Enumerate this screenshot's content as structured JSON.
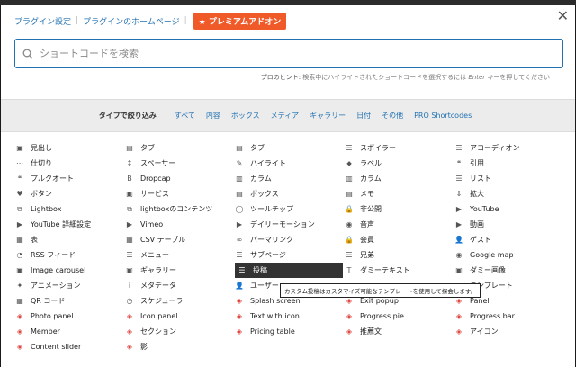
{
  "topbar": {
    "plugin_settings": "プラグイン設定",
    "plugin_home": "プラグインのホームページ",
    "separator": "|",
    "premium_label": "★ プレミアムアドオン",
    "close": "✕"
  },
  "search": {
    "placeholder": "ショートコードを検索"
  },
  "hint": {
    "prefix": "プロのヒント:",
    "text1": " 検索中にハイライトされたショートコードを選択するには ",
    "key": "Enter",
    "text2": " キーを押してください"
  },
  "filters": {
    "label": "タイプで絞り込み",
    "tabs": [
      "すべて",
      "内容",
      "ボックス",
      "メディア",
      "ギャラリー",
      "日付",
      "その他",
      "PRO Shortcodes"
    ]
  },
  "tooltip": "カスタム投稿はカスタマイズ可能なテンプレートを使用して探会します。",
  "rows": [
    [
      [
        "見出し",
        "▣",
        ""
      ],
      [
        "タブ",
        "▤",
        ""
      ],
      [
        "タブ",
        "▤",
        ""
      ],
      [
        "スポイラー",
        "☰",
        ""
      ],
      [
        "アコーディオン",
        "☰",
        ""
      ]
    ],
    [
      [
        "仕切り",
        "⋯",
        ""
      ],
      [
        "スペーサー",
        "↕",
        ""
      ],
      [
        "ハイライト",
        "✎",
        ""
      ],
      [
        "ラベル",
        "⬥",
        ""
      ],
      [
        "引用",
        "❝",
        ""
      ]
    ],
    [
      [
        "プルクオート",
        "❝",
        ""
      ],
      [
        "Dropcap",
        "B",
        ""
      ],
      [
        "カラム",
        "▥",
        ""
      ],
      [
        "カラム",
        "▥",
        ""
      ],
      [
        "リスト",
        "☰",
        ""
      ]
    ],
    [
      [
        "ボタン",
        "♥",
        ""
      ],
      [
        "サービス",
        "▣",
        ""
      ],
      [
        "ボックス",
        "▤",
        ""
      ],
      [
        "メモ",
        "▤",
        ""
      ],
      [
        "拡大",
        "⇕",
        ""
      ]
    ],
    [
      [
        "Lightbox",
        "⧉",
        ""
      ],
      [
        "lightboxのコンテンツ",
        "⧉",
        ""
      ],
      [
        "ツールチップ",
        "◯",
        ""
      ],
      [
        "非公開",
        "🔒",
        ""
      ],
      [
        "YouTube",
        "▶",
        ""
      ]
    ],
    [
      [
        "YouTube 詳細設定",
        "▶",
        ""
      ],
      [
        "Vimeo",
        "▶",
        ""
      ],
      [
        "デイリーモーション",
        "▶",
        ""
      ],
      [
        "音声",
        "◉",
        ""
      ],
      [
        "動画",
        "▶",
        ""
      ]
    ],
    [
      [
        "表",
        "▦",
        ""
      ],
      [
        "CSV テーブル",
        "▦",
        ""
      ],
      [
        "パーマリンク",
        "∞",
        ""
      ],
      [
        "会員",
        "🔒",
        ""
      ],
      [
        "ゲスト",
        "👤",
        ""
      ]
    ],
    [
      [
        "RSS フィード",
        "◔",
        ""
      ],
      [
        "メニュー",
        "☰",
        ""
      ],
      [
        "サブページ",
        "☰",
        ""
      ],
      [
        "兄弟",
        "☰",
        ""
      ],
      [
        "Google map",
        "◉",
        ""
      ]
    ],
    [
      [
        "Image carousel",
        "▣",
        ""
      ],
      [
        "ギャラリー",
        "▣",
        ""
      ],
      [
        "投稿",
        "☰",
        "sel"
      ],
      [
        "ダミーテキスト",
        "T",
        ""
      ],
      [
        "ダミー画像",
        "▣",
        ""
      ]
    ],
    [
      [
        "アニメーション",
        "✦",
        ""
      ],
      [
        "メタデータ",
        "i",
        ""
      ],
      [
        "ユーザー",
        "👤",
        ""
      ],
      [
        "",
        "",
        ""
      ],
      [
        "テンプレート",
        "▤",
        ""
      ]
    ],
    [
      [
        "QR コード",
        "▦",
        ""
      ],
      [
        "スケジューラ",
        "◷",
        ""
      ],
      [
        "Splash screen",
        "◈",
        "red"
      ],
      [
        "Exit popup",
        "◈",
        "red"
      ],
      [
        "Panel",
        "◈",
        "red"
      ]
    ],
    [
      [
        "Photo panel",
        "◈",
        "red"
      ],
      [
        "Icon panel",
        "◈",
        "red"
      ],
      [
        "Text with icon",
        "◈",
        "red"
      ],
      [
        "Progress pie",
        "◈",
        "red"
      ],
      [
        "Progress bar",
        "◈",
        "red"
      ]
    ],
    [
      [
        "Member",
        "◈",
        "red"
      ],
      [
        "セクション",
        "◈",
        "red"
      ],
      [
        "Pricing table",
        "◈",
        "red"
      ],
      [
        "推薦文",
        "◈",
        "red"
      ],
      [
        "アイコン",
        "◈",
        "red"
      ]
    ],
    [
      [
        "Content slider",
        "◈",
        "red"
      ],
      [
        "影",
        "◈",
        "red"
      ],
      [
        "",
        "",
        ""
      ],
      [
        "",
        "",
        ""
      ],
      [
        "",
        "",
        ""
      ]
    ]
  ]
}
